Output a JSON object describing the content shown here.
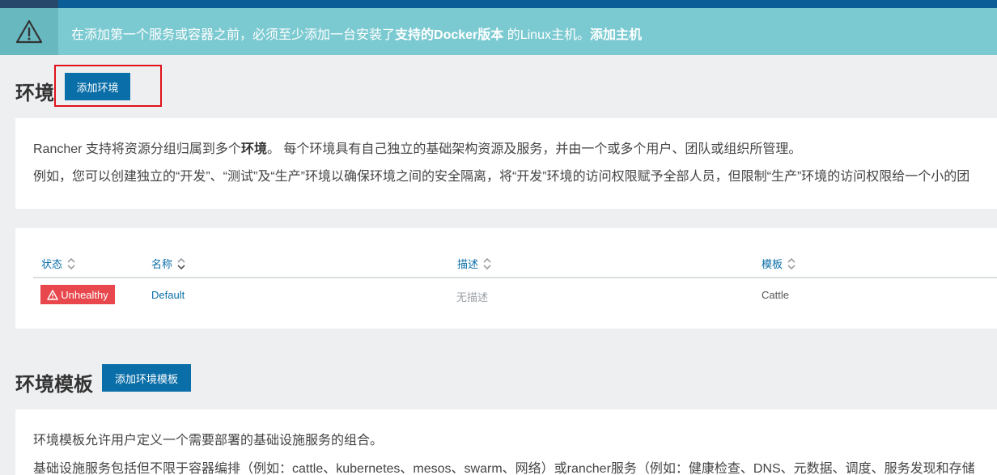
{
  "alert": {
    "text_before": "在添加第一个服务或容器之前，必须至少添加一台安装了",
    "link_docker": "支持的Docker版本",
    "text_after": " 的Linux主机。",
    "link_add_host": "添加主机"
  },
  "environments": {
    "title": "环境",
    "add_button": "添加环境",
    "intro_line1_before": "Rancher 支持将资源分组归属到多个",
    "intro_line1_bold": "环境",
    "intro_line1_after": "。 每个环境具有自己独立的基础架构资源及服务，并由一个或多个用户、团队或组织所管理。",
    "intro_line2": "例如，您可以创建独立的“开发”、“测试”及“生产”环境以确保环境之间的安全隔离，将“开发”环境的访问权限赋予全部人员，但限制“生产”环境的访问权限给一个小的团",
    "table": {
      "columns": [
        "状态",
        "名称",
        "描述",
        "模板"
      ],
      "rows": [
        {
          "status": "Unhealthy",
          "name": "Default",
          "description": "无描述",
          "template": "Cattle"
        }
      ]
    }
  },
  "templates": {
    "title": "环境模板",
    "add_button": "添加环境模板",
    "intro_line1": "环境模板允许用户定义一个需要部署的基础设施服务的组合。",
    "intro_line2": "基础设施服务包括但不限于容器编排（例如：cattle、kubernetes、mesos、swarm、网络）或rancher服务（例如：健康检查、DNS、元数据、调度、服务发现和存储"
  },
  "colors": {
    "accent": "#0a6ea8",
    "alert_bg": "#7ccad1",
    "unhealthy": "#e8484d",
    "highlight": "#e0121b"
  },
  "icons": {
    "alert": "warning-triangle-icon",
    "sort": "sort-icon",
    "status": "warning-triangle-icon"
  }
}
